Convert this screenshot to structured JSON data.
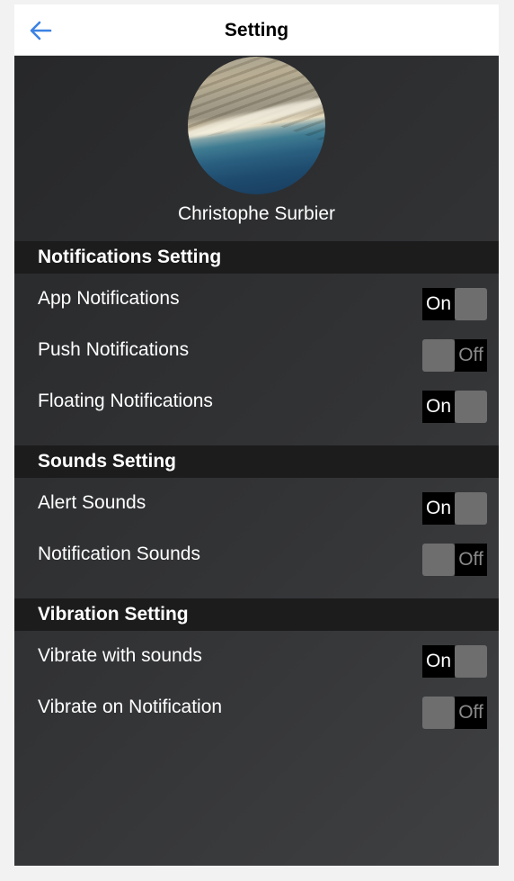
{
  "header": {
    "title": "Setting",
    "back_icon": "arrow-left-icon",
    "accent_color": "#3a82e4"
  },
  "profile": {
    "name": "Christophe Surbier"
  },
  "sections": {
    "notifications": {
      "title": "Notifications Setting",
      "items": [
        {
          "label": "App Notifications",
          "state": "On"
        },
        {
          "label": "Push Notifications",
          "state": "Off"
        },
        {
          "label": "Floating Notifications",
          "state": "On"
        }
      ]
    },
    "sounds": {
      "title": "Sounds Setting",
      "items": [
        {
          "label": "Alert Sounds",
          "state": "On"
        },
        {
          "label": "Notification Sounds",
          "state": "Off"
        }
      ]
    },
    "vibration": {
      "title": "Vibration Setting",
      "items": [
        {
          "label": "Vibrate with sounds",
          "state": "On"
        },
        {
          "label": "Vibrate on Notification",
          "state": "Off"
        }
      ]
    }
  }
}
